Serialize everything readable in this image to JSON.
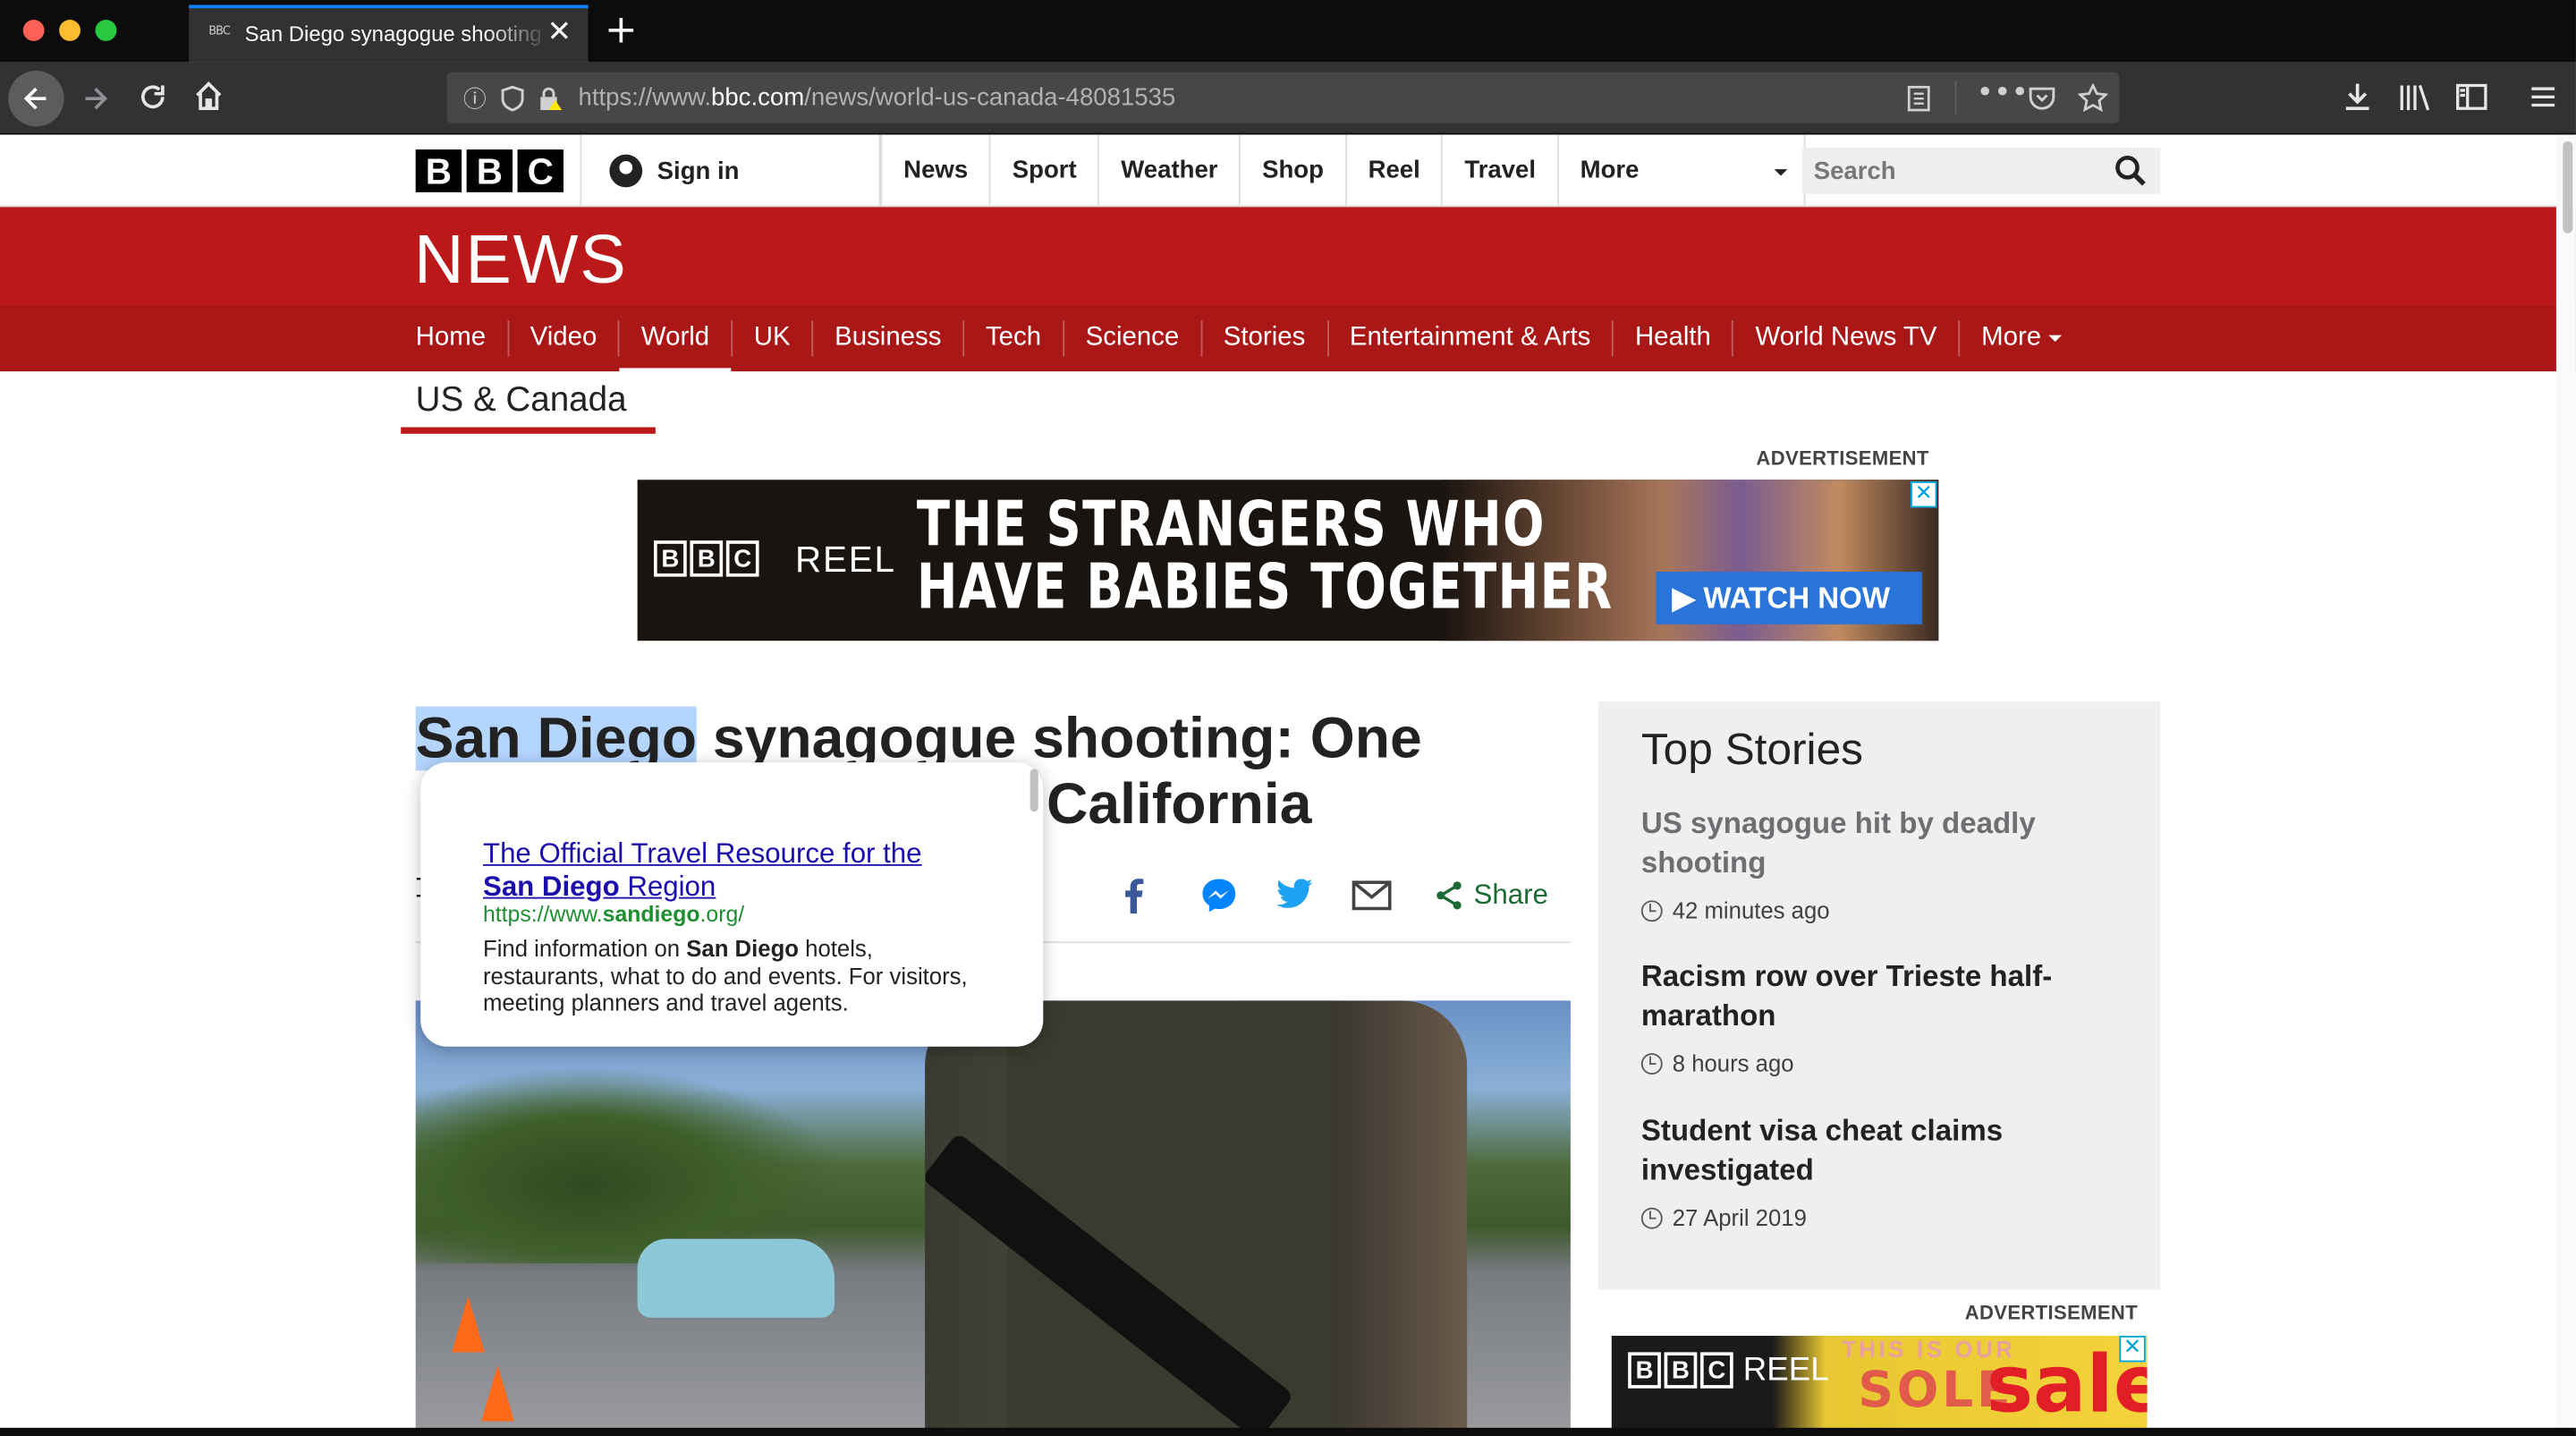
{
  "browser": {
    "tab_title": "San Diego synagogue shooting: One",
    "tab_favicon": "BBC",
    "new_tab": "+",
    "url_prefix": "https://www.",
    "url_domain": "bbc.com",
    "url_path": "/news/world-us-canada-48081535",
    "icons": [
      "back-icon",
      "forward-icon",
      "reload-icon",
      "home-icon",
      "info-icon",
      "shield-icon",
      "lock-warning-icon",
      "reader-view-icon",
      "more-icon",
      "pocket-icon",
      "bookmark-star-icon",
      "download-icon",
      "library-icon",
      "sidebar-icon",
      "menu-icon"
    ]
  },
  "bbc_bar": {
    "logo": [
      "B",
      "B",
      "C"
    ],
    "sign_in": "Sign in",
    "nav": [
      "News",
      "Sport",
      "Weather",
      "Shop",
      "Reel",
      "Travel",
      "More"
    ],
    "search_placeholder": "Search"
  },
  "news": {
    "logo": "NEWS",
    "sections": [
      "Home",
      "Video",
      "World",
      "UK",
      "Business",
      "Tech",
      "Science",
      "Stories",
      "Entertainment & Arts",
      "Health",
      "World News TV",
      "More"
    ],
    "active_section": "World",
    "subsection": "US & Canada"
  },
  "ad1": {
    "label": "ADVERTISEMENT",
    "brand": [
      "B",
      "B",
      "C"
    ],
    "reel": "REEL",
    "headline_line1": "THE STRANGERS WHO",
    "headline_line2": "HAVE BABIES TOGETHER",
    "cta": "▶ WATCH NOW",
    "close": "✕"
  },
  "article": {
    "headline_selected": "San Diego",
    "headline_rest": " synagogue shooting: One",
    "headline_line2_visible": "California",
    "share_label": "Share",
    "share_icons": [
      "facebook-icon",
      "messenger-icon",
      "twitter-icon",
      "email-icon",
      "share-icon"
    ]
  },
  "popup": {
    "title_pre": "The Official Travel Resource for the ",
    "title_bold": "San Diego",
    "title_post": " Region",
    "url_pre": "https://www.",
    "url_bold": "sandiego",
    "url_post": ".org/",
    "desc_pre": "Find information on ",
    "desc_bold": "San Diego",
    "desc_post": " hotels, restaurants, what to do and events. For visitors, meeting planners and travel agents."
  },
  "top_stories": {
    "title": "Top Stories",
    "items": [
      {
        "headline": "US synagogue hit by deadly shooting",
        "time": "42 minutes ago"
      },
      {
        "headline": "Racism row over Trieste half-marathon",
        "time": "8 hours ago"
      },
      {
        "headline": "Student visa cheat claims investigated",
        "time": "27 April 2019"
      }
    ]
  },
  "ad2": {
    "label": "ADVERTISEMENT",
    "brand": [
      "B",
      "B",
      "C"
    ],
    "reel": "REEL",
    "overlay_top": "THIS IS OUR",
    "overlay_mid": "SOLE",
    "sale": "sale",
    "close": "✕"
  }
}
